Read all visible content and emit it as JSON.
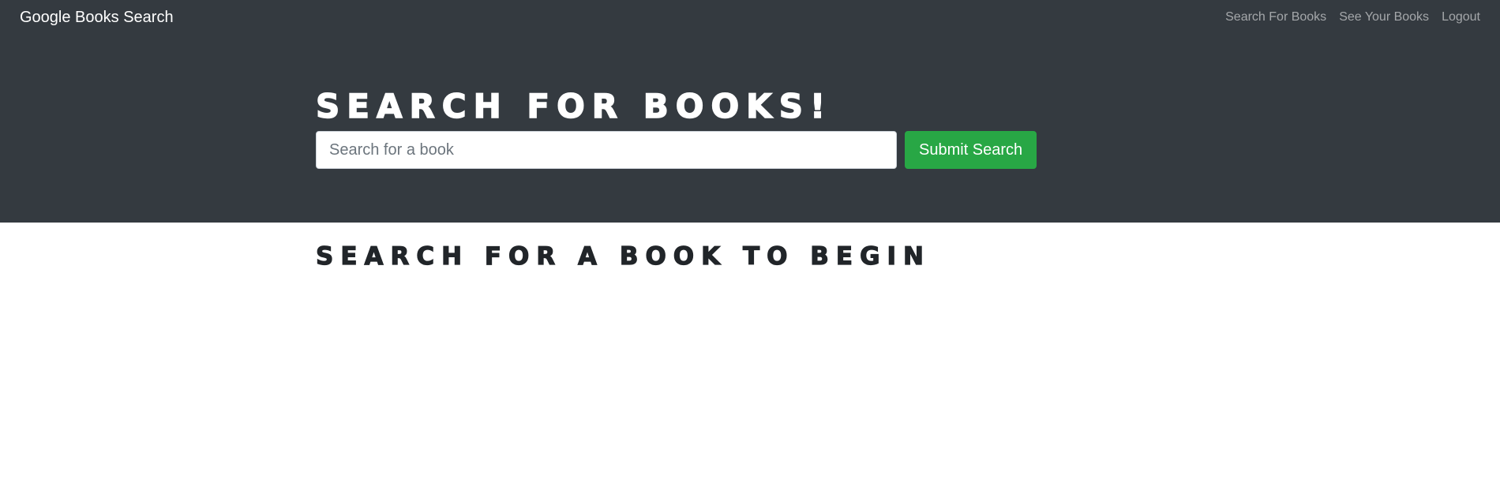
{
  "navbar": {
    "brand": "Google Books Search",
    "links": [
      "Search For Books",
      "See Your Books",
      "Logout"
    ]
  },
  "hero": {
    "title": "Search for Books!",
    "search": {
      "placeholder": "Search for a book",
      "value": ""
    },
    "submit_label": "Submit Search"
  },
  "results": {
    "heading": "Search for a book to begin"
  },
  "colors": {
    "header_bg": "#343a40",
    "button_green": "#28a745",
    "nav_link": "rgba(255,255,255,0.55)",
    "heading_dark": "#212529"
  }
}
